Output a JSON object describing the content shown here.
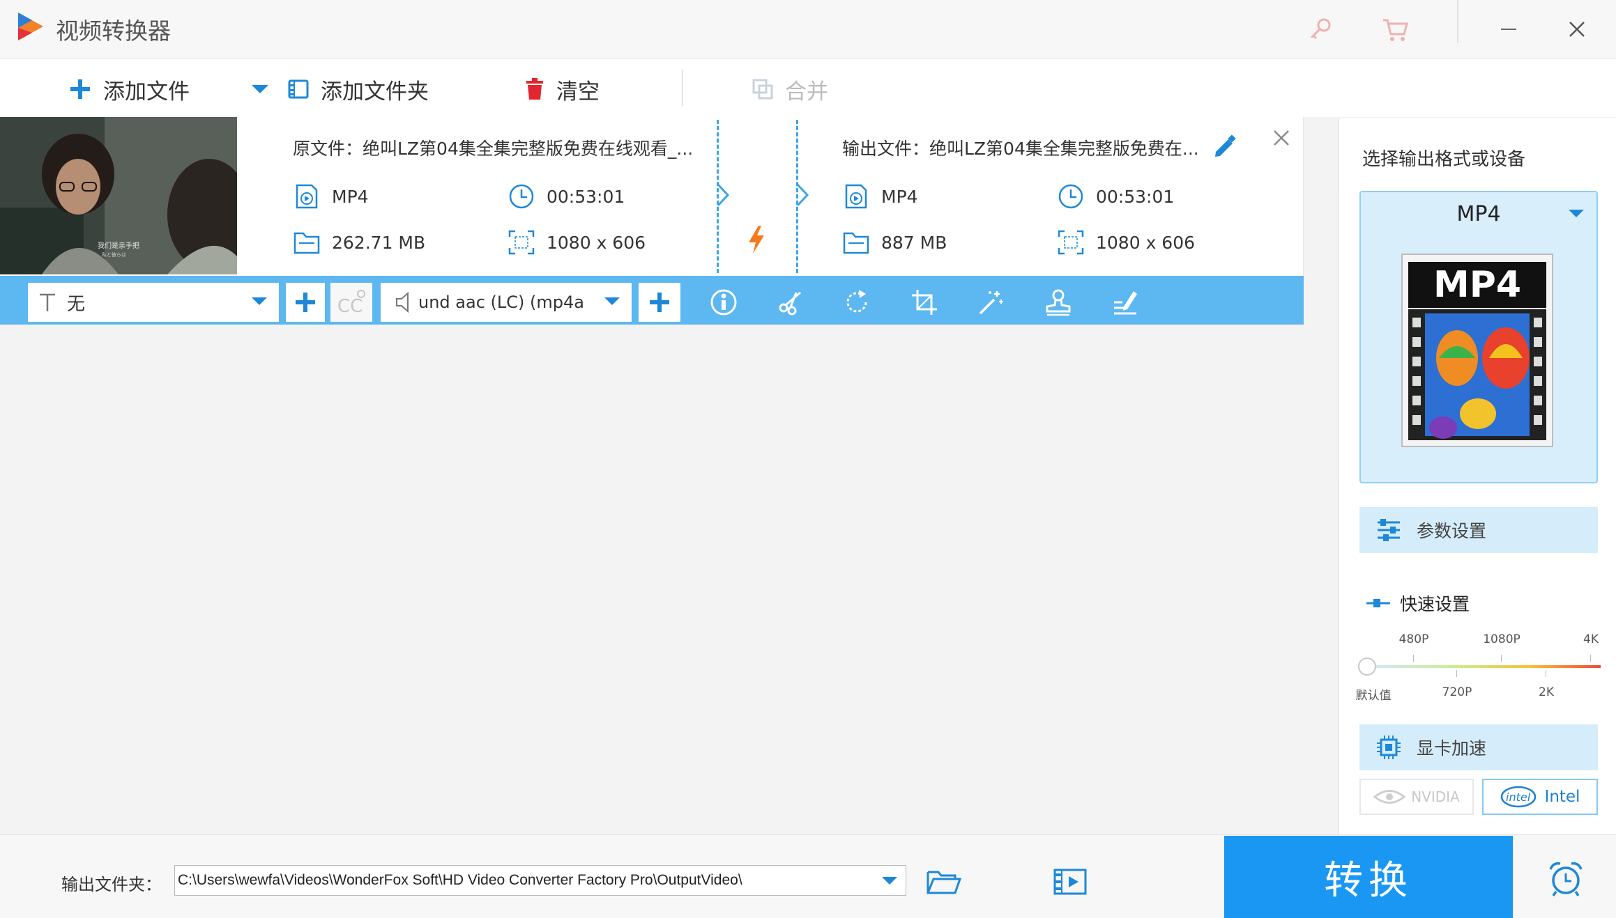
{
  "app": {
    "title": "视频转换器"
  },
  "toolbar": {
    "add_file": "添加文件",
    "add_folder": "添加文件夹",
    "clear": "清空",
    "merge": "合并"
  },
  "file_item": {
    "source": {
      "name": "原文件：绝叫LZ第04集全集完整版免费在线观看_...",
      "format": "MP4",
      "duration": "00:53:01",
      "size": "262.71 MB",
      "resolution": "1080 x 606"
    },
    "output": {
      "name": "输出文件：绝叫LZ第04集全集完整版免费在...",
      "format": "MP4",
      "duration": "00:53:01",
      "size": "887 MB",
      "resolution": "1080 x 606"
    },
    "thumbnail_caption": "我们是亲手把",
    "thumbnail_caption2": "私と彼らは"
  },
  "edit_bar": {
    "subtitle_value": "无",
    "cc_label": "CC",
    "audio_value": "und aac (LC) (mp4a"
  },
  "right_panel": {
    "heading": "选择输出格式或设备",
    "format_name": "MP4",
    "format_icon_text": "MP4",
    "params_label": "参数设置",
    "quick_title": "快速设置",
    "quality_top": [
      "480P",
      "1080P",
      "4K"
    ],
    "quality_bottom": [
      "默认值",
      "720P",
      "2K"
    ],
    "quality_level": 0,
    "gpu_label": "显卡加速",
    "nvidia_label": "NVIDIA",
    "intel_label": "Intel",
    "intel_badge": "intel"
  },
  "bottom": {
    "output_label": "输出文件夹：",
    "output_path": "C:\\Users\\wewfa\\Videos\\WonderFox Soft\\HD Video Converter Factory Pro\\OutputVideo\\",
    "convert_label": "转换"
  },
  "colors": {
    "accent": "#1a96f3",
    "edit_bar": "#5db7f0",
    "icon_blue": "#1e88d8"
  }
}
